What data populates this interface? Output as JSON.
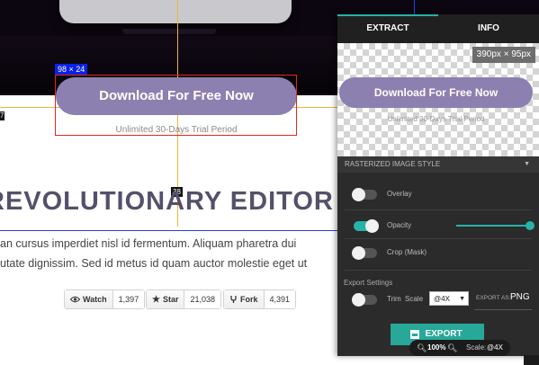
{
  "canvas": {
    "selection_badge": "98 × 24",
    "download_button": "Download For Free Now",
    "download_sub": "Unlimited 30-Days Trial Period",
    "left_tag": "7",
    "distance_badge": "38",
    "headline": "REVOLUTIONARY EDITOR",
    "para_lines": [
      "an cursus imperdiet nisl id fermentum. Aliquam pharetra dui",
      "utate dignissim. Sed id metus id quam auctor molestie eget ut"
    ],
    "github": [
      {
        "label": "Watch",
        "count": "1,397",
        "icon": "eye-icon"
      },
      {
        "label": "Star",
        "count": "21,038",
        "icon": "star-icon"
      },
      {
        "label": "Fork",
        "count": "4,391",
        "icon": "fork-icon"
      }
    ]
  },
  "panel": {
    "tabs": [
      {
        "label": "EXTRACT",
        "active": true
      },
      {
        "label": "INFO",
        "active": false
      }
    ],
    "preview": {
      "dims": "390px × 95px",
      "button": "Download For Free Now",
      "sub": "Unlimited 30-Days Trial Period"
    },
    "section_title": "RASTERIZED IMAGE STYLE",
    "options": [
      {
        "label": "Overlay",
        "on": false
      },
      {
        "label": "Opacity",
        "on": true,
        "level": 1.0
      },
      {
        "label": "Crop (Mask)",
        "on": false
      }
    ],
    "export_settings": {
      "title": "Export Settings",
      "trim_label": "Trim",
      "scale_label": "Scale",
      "scale_value": "@4X",
      "export_as_label": "EXPORT AS:",
      "format": "PNG"
    },
    "export_button": "EXPORT"
  },
  "status": {
    "zoom": "100%",
    "scale_label": "Scale:",
    "scale_value": "@4X"
  },
  "colors": {
    "accent": "#26b3a8",
    "button": "#8c80b0",
    "selection": "#e0281e",
    "guide": "#f0b435"
  }
}
